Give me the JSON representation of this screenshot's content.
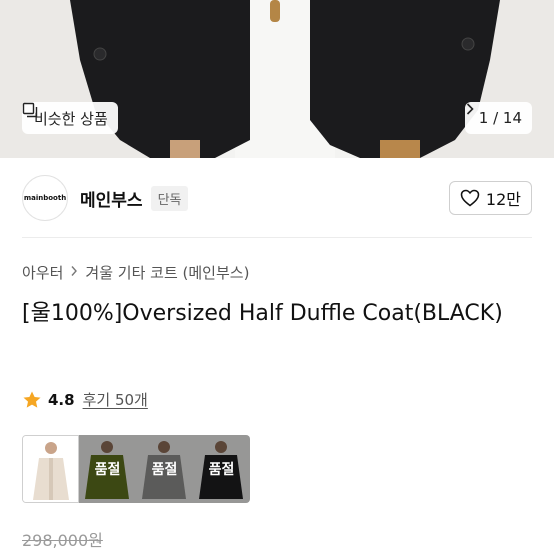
{
  "hero": {
    "similar_label": "비슷한 상품",
    "similar_icon": "similar-products-icon",
    "pager_text": "1 / 14",
    "pager_icon": "chevron-right-icon"
  },
  "brand": {
    "logo_text": "mainbooth",
    "name": "메인부스",
    "tag": "단독",
    "like_icon": "heart-outline-icon",
    "like_count": "12만"
  },
  "breadcrumb": {
    "items": [
      "아우터",
      "겨울 기타 코트 (메인부스)"
    ],
    "separator_icon": "chevron-right-icon"
  },
  "product": {
    "title": "[울100%]Oversized Half Duffle Coat(BLACK)"
  },
  "rating": {
    "icon": "star-icon",
    "score": "4.8",
    "reviews": "후기 50개"
  },
  "options": [
    {
      "name": "ivory",
      "sold_out": false,
      "label": ""
    },
    {
      "name": "khaki",
      "sold_out": true,
      "label": "품절"
    },
    {
      "name": "gray",
      "sold_out": true,
      "label": "품절"
    },
    {
      "name": "black",
      "sold_out": true,
      "label": "품절"
    }
  ],
  "price": {
    "original": "298,000원"
  },
  "colors": {
    "star": "#f5a623",
    "text": "#111111",
    "muted": "#9a9a9a"
  }
}
